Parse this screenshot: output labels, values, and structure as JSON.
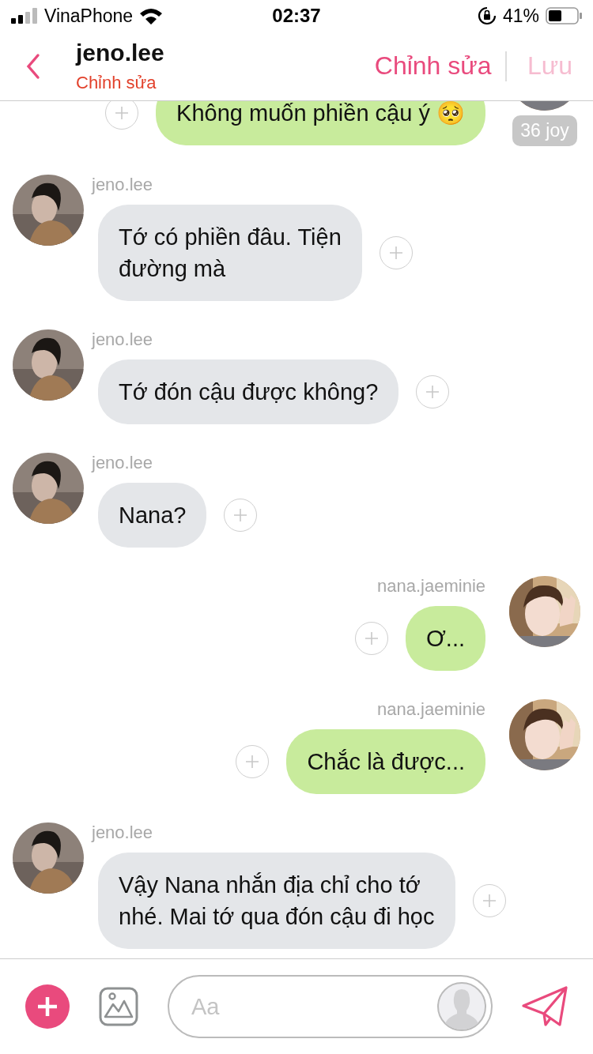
{
  "status_bar": {
    "carrier": "VinaPhone",
    "time": "02:37",
    "battery": "41%"
  },
  "header": {
    "title": "jeno.lee",
    "subtitle": "Chỉnh sửa",
    "edit_button": "Chỉnh sửa",
    "save_button": {
      "label": "Lưu",
      "disabled": true
    }
  },
  "messages": [
    {
      "kind": "sent",
      "text": "Không muốn phiền cậu ý 🥺",
      "reaction": "36 joy"
    },
    {
      "kind": "received",
      "sender": "jeno.lee",
      "text": "Tớ có phiền đâu. Tiện\nđường mà"
    },
    {
      "kind": "received",
      "sender": "jeno.lee",
      "text": "Tớ đón cậu được không?"
    },
    {
      "kind": "received",
      "sender": "jeno.lee",
      "text": "Nana?"
    },
    {
      "kind": "sent",
      "sender": "nana.jaeminie",
      "text": "Ơ..."
    },
    {
      "kind": "sent",
      "sender": "nana.jaeminie",
      "text": "Chắc là được..."
    },
    {
      "kind": "received",
      "sender": "jeno.lee",
      "text": "Vậy Nana nhắn địa chỉ cho tớ\nnhé. Mai tớ qua đón cậu đi học"
    }
  ],
  "composer": {
    "placeholder": "Aa"
  }
}
